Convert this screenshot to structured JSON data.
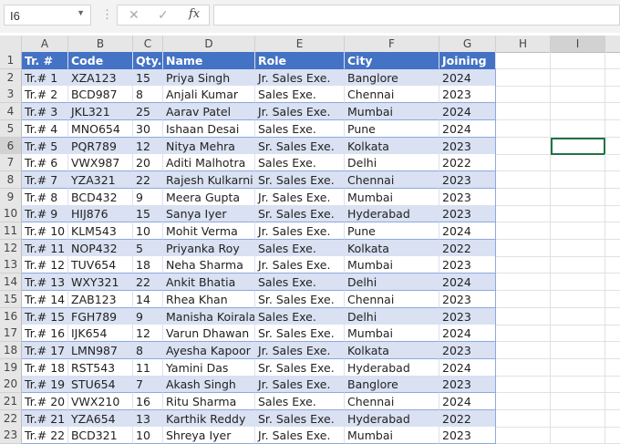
{
  "formula_bar": {
    "name_box": "I6",
    "cancel_icon": "✕",
    "enter_icon": "✓",
    "fx_label": "fx",
    "formula": ""
  },
  "columns": [
    "A",
    "B",
    "C",
    "D",
    "E",
    "F",
    "G",
    "H",
    "I"
  ],
  "selected_cell": "I6",
  "table": {
    "headers": [
      "Tr. #",
      "Code",
      "Qty.",
      "Name",
      "Role",
      "City",
      "Joining"
    ],
    "rows": [
      [
        "Tr.# 1",
        "XZA123",
        "15",
        "Priya Singh",
        "Jr. Sales Exe.",
        "Banglore",
        "2024"
      ],
      [
        "Tr.# 2",
        "BCD987",
        "8",
        "Anjali Kumar",
        "Sales Exe.",
        "Chennai",
        "2023"
      ],
      [
        "Tr.# 3",
        "JKL321",
        "25",
        "Aarav Patel",
        "Jr. Sales Exe.",
        "Mumbai",
        "2024"
      ],
      [
        "Tr.# 4",
        "MNO654",
        "30",
        "Ishaan Desai",
        "Sales Exe.",
        "Pune",
        "2024"
      ],
      [
        "Tr.# 5",
        "PQR789",
        "12",
        "Nitya Mehra",
        "Sr. Sales Exe.",
        "Kolkata",
        "2023"
      ],
      [
        "Tr.# 6",
        "VWX987",
        "20",
        "Aditi Malhotra",
        "Sales Exe.",
        "Delhi",
        "2022"
      ],
      [
        "Tr.# 7",
        "YZA321",
        "22",
        "Rajesh Kulkarni",
        "Sr. Sales Exe.",
        "Chennai",
        "2023"
      ],
      [
        "Tr.# 8",
        "BCD432",
        "9",
        "Meera Gupta",
        "Jr. Sales Exe.",
        "Mumbai",
        "2023"
      ],
      [
        "Tr.# 9",
        "HIJ876",
        "15",
        "Sanya Iyer",
        "Sr. Sales Exe.",
        "Hyderabad",
        "2023"
      ],
      [
        "Tr.# 10",
        "KLM543",
        "10",
        "Mohit Verma",
        "Jr. Sales Exe.",
        "Pune",
        "2024"
      ],
      [
        "Tr.# 11",
        "NOP432",
        "5",
        "Priyanka Roy",
        "Sales Exe.",
        "Kolkata",
        "2022"
      ],
      [
        "Tr.# 12",
        "TUV654",
        "18",
        "Neha Sharma",
        "Jr. Sales Exe.",
        "Mumbai",
        "2023"
      ],
      [
        "Tr.# 13",
        "WXY321",
        "22",
        "Ankit Bhatia",
        "Sales Exe.",
        "Delhi",
        "2024"
      ],
      [
        "Tr.# 14",
        "ZAB123",
        "14",
        "Rhea Khan",
        "Sr. Sales Exe.",
        "Chennai",
        "2023"
      ],
      [
        "Tr.# 15",
        "FGH789",
        "9",
        "Manisha Koirala",
        "Sales Exe.",
        "Delhi",
        "2023"
      ],
      [
        "Tr.# 16",
        "IJK654",
        "12",
        "Varun Dhawan",
        "Sr. Sales Exe.",
        "Mumbai",
        "2024"
      ],
      [
        "Tr.# 17",
        "LMN987",
        "8",
        "Ayesha Kapoor",
        "Jr. Sales Exe.",
        "Kolkata",
        "2023"
      ],
      [
        "Tr.# 18",
        "RST543",
        "11",
        "Yamini Das",
        "Sr. Sales Exe.",
        "Hyderabad",
        "2024"
      ],
      [
        "Tr.# 19",
        "STU654",
        "7",
        "Akash Singh",
        "Jr. Sales Exe.",
        "Banglore",
        "2023"
      ],
      [
        "Tr.# 20",
        "VWX210",
        "16",
        "Ritu Sharma",
        "Sales Exe.",
        "Chennai",
        "2024"
      ],
      [
        "Tr.# 21",
        "YZA654",
        "13",
        "Karthik Reddy",
        "Sr. Sales Exe.",
        "Hyderabad",
        "2022"
      ],
      [
        "Tr.# 22",
        "BCD321",
        "10",
        "Shreya Iyer",
        "Jr. Sales Exe.",
        "Mumbai",
        "2023"
      ]
    ]
  },
  "colors": {
    "header": "#4472c4",
    "band": "#d9e1f2",
    "selection": "#217346"
  }
}
